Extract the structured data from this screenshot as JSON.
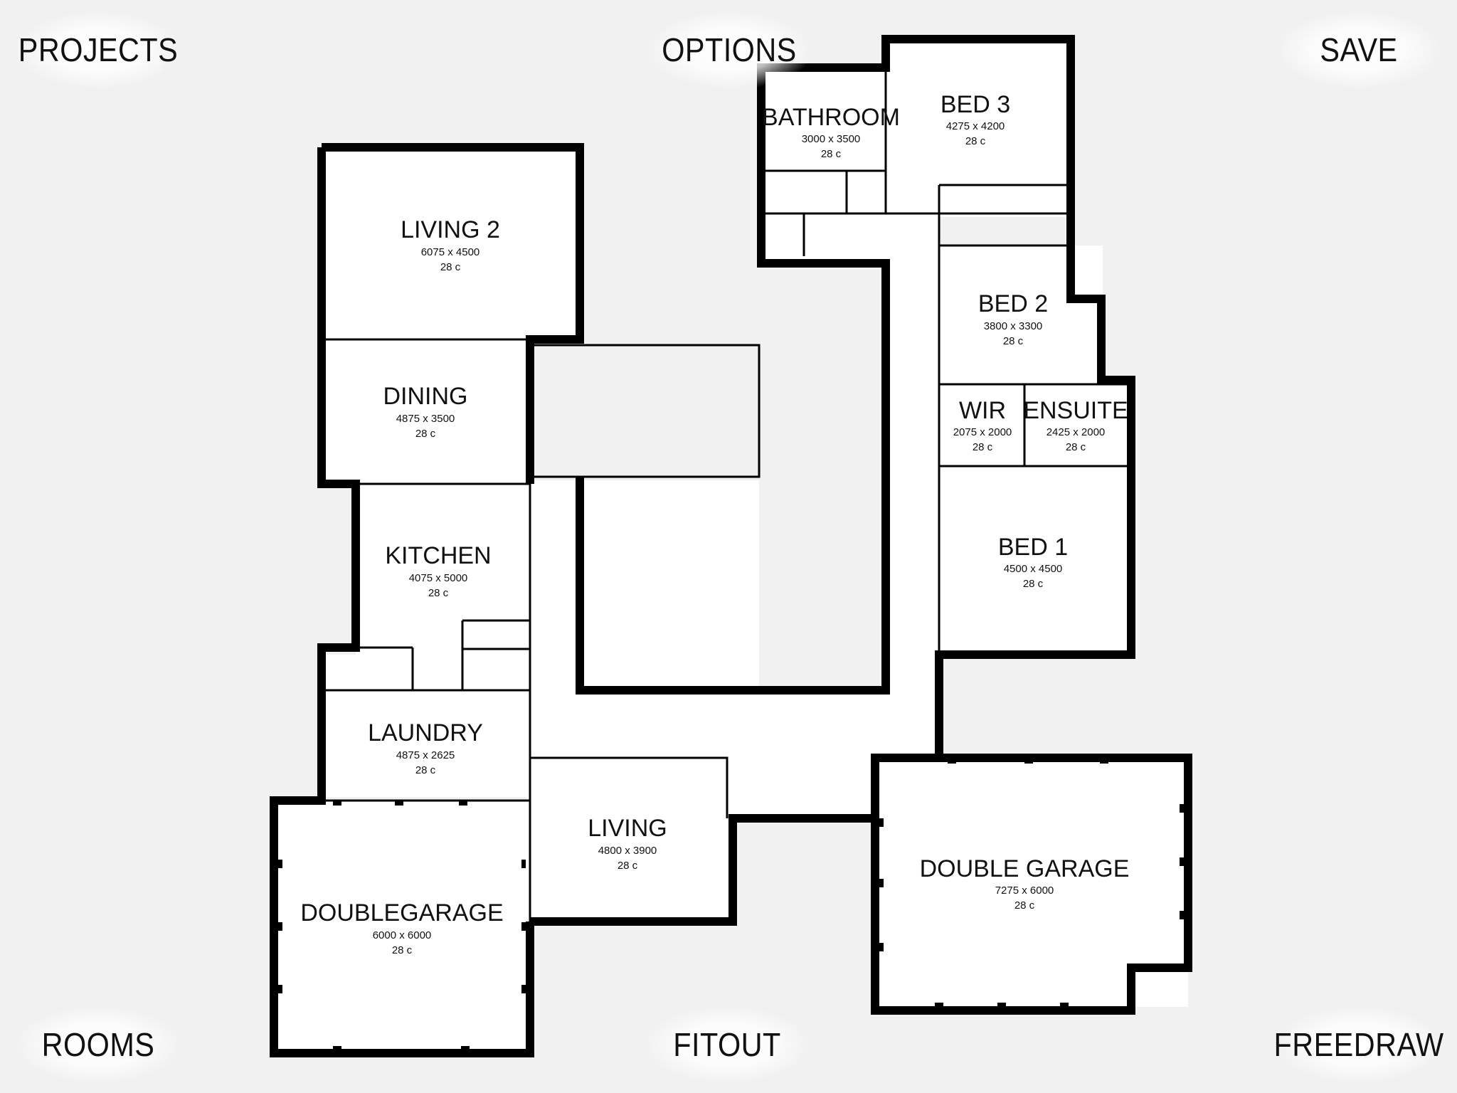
{
  "menu": {
    "projects": "PROJECTS",
    "options": "OPTIONS",
    "save": "SAVE",
    "rooms": "ROOMS",
    "fitout": "FITOUT",
    "freedraw": "FREEDRAW"
  },
  "rooms": {
    "living2": {
      "name": "LIVING 2",
      "dims": "6075 x 4500",
      "ceiling": "28 c"
    },
    "dining": {
      "name": "DINING",
      "dims": "4875 x 3500",
      "ceiling": "28 c"
    },
    "kitchen": {
      "name": "KITCHEN",
      "dims": "4075 x 5000",
      "ceiling": "28 c"
    },
    "laundry": {
      "name": "LAUNDRY",
      "dims": "4875 x 2625",
      "ceiling": "28 c"
    },
    "doublegarage_left": {
      "name": "DOUBLEGARAGE",
      "dims": "6000 x 6000",
      "ceiling": "28 c"
    },
    "living": {
      "name": "LIVING",
      "dims": "4800 x 3900",
      "ceiling": "28 c"
    },
    "bathroom": {
      "name": "BATHROOM",
      "dims": "3000 x 3500",
      "ceiling": "28 c"
    },
    "bed3": {
      "name": "BED 3",
      "dims": "4275 x 4200",
      "ceiling": "28 c"
    },
    "bed2": {
      "name": "BED 2",
      "dims": "3800 x 3300",
      "ceiling": "28 c"
    },
    "wir": {
      "name": "WIR",
      "dims": "2075 x 2000",
      "ceiling": "28 c"
    },
    "ensuite": {
      "name": "ENSUITE",
      "dims": "2425 x 2000",
      "ceiling": "28 c"
    },
    "bed1": {
      "name": "BED 1",
      "dims": "4500 x 4500",
      "ceiling": "28 c"
    },
    "doublegarage_right": {
      "name": "DOUBLE GARAGE",
      "dims": "7275 x 6000",
      "ceiling": "28 c"
    }
  }
}
